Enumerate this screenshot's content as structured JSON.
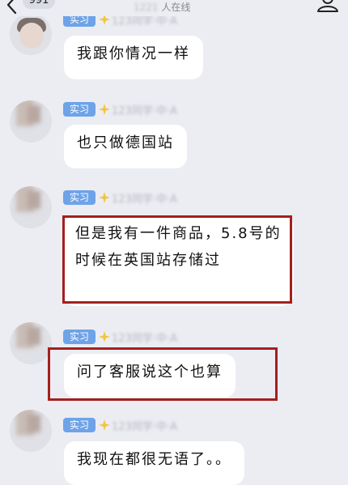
{
  "header": {
    "back_count": "991",
    "online_count": "1221",
    "online_label": "人在线"
  },
  "messages": [
    {
      "badge": "实习",
      "sender": "123同学·中·A",
      "text": "我跟你情况一样"
    },
    {
      "badge": "实习",
      "sender": "123同学·中·A",
      "text": "也只做德国站"
    },
    {
      "badge": "实习",
      "sender": "123同学·中·A",
      "text": "但是我有一件商品，5.8号的时候在英国站存储过"
    },
    {
      "badge": "实习",
      "sender": "123同学·中·A",
      "text": "问了客服说这个也算"
    },
    {
      "badge": "实习",
      "sender": "123同学·中·A",
      "text": "我现在都很无语了。。"
    }
  ],
  "colors": {
    "background": "#ebedf2",
    "badge": "#6ea3e8",
    "highlight_frame": "#a3201d",
    "bubble": "#ffffff"
  },
  "icons": [
    "chevron-left-icon",
    "group-members-icon",
    "sparkle-icon"
  ]
}
